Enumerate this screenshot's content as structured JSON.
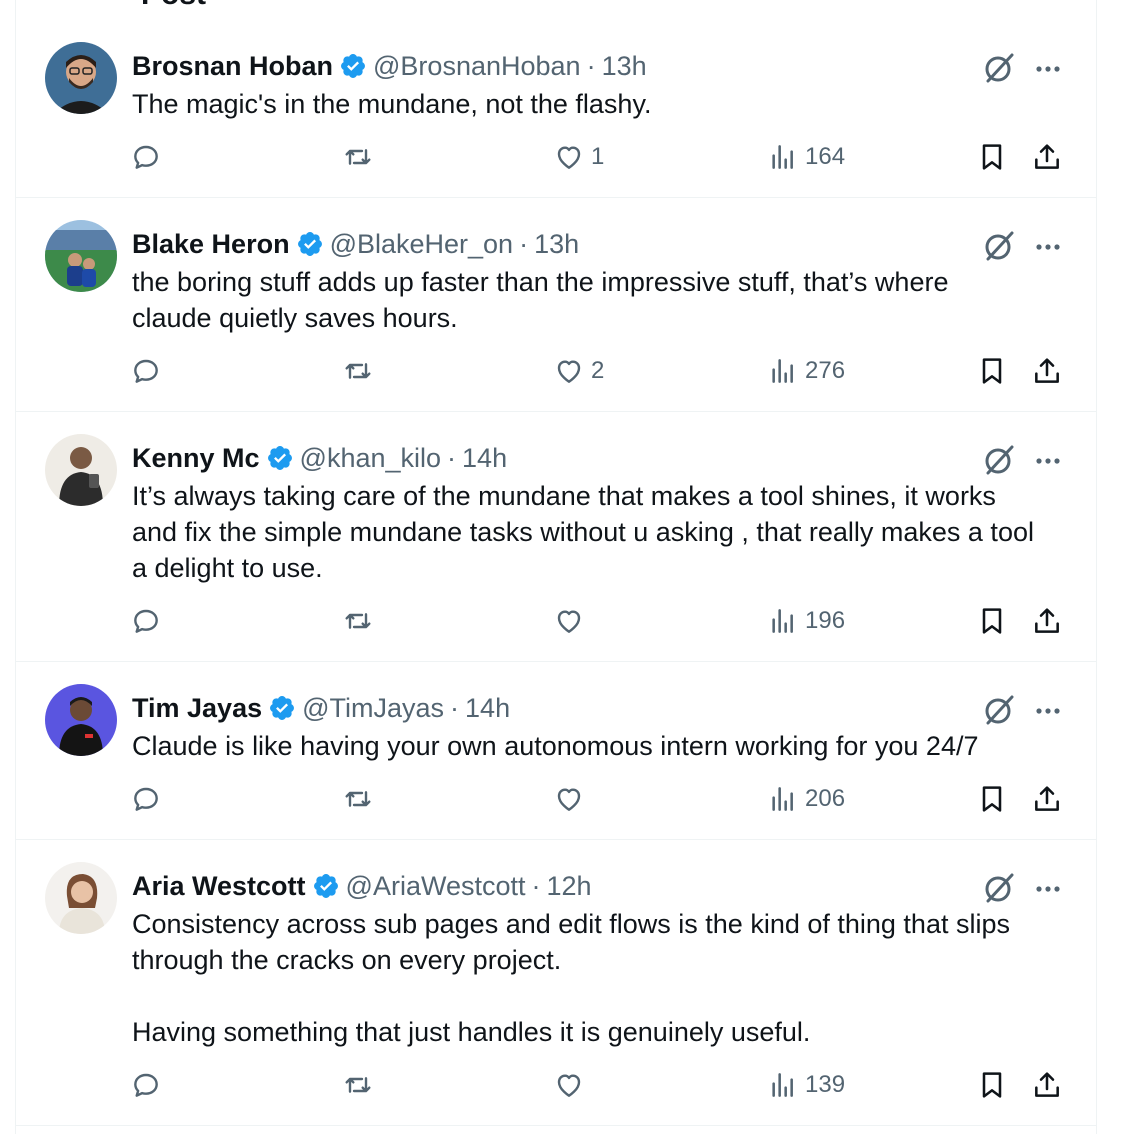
{
  "header": {
    "title": "Post"
  },
  "colors": {
    "verified": "#1d9bf0",
    "muted": "#536471",
    "text": "#0f1419"
  },
  "tweets": [
    {
      "name": "Brosnan Hoban",
      "handle": "@BrosnanHoban",
      "sep": "·",
      "time": "13h",
      "body": "The magic's in the mundane, not the flashy.",
      "replies": "",
      "reposts": "",
      "likes": "1",
      "views": "164"
    },
    {
      "name": "Blake Heron",
      "handle": "@BlakeHer_on",
      "sep": "·",
      "time": "13h",
      "body": "the boring stuff adds up faster than the impressive stuff, that’s where\nclaude quietly saves hours.",
      "replies": "",
      "reposts": "",
      "likes": "2",
      "views": "276"
    },
    {
      "name": "Kenny Mc",
      "handle": "@khan_kilo",
      "sep": "·",
      "time": "14h",
      "body": "It’s always taking care of the mundane that makes a tool shines, it works\nand fix the simple mundane tasks without u asking , that really makes a tool\na delight to use.",
      "replies": "",
      "reposts": "",
      "likes": "",
      "views": "196"
    },
    {
      "name": "Tim Jayas",
      "handle": "@TimJayas",
      "sep": "·",
      "time": "14h",
      "body": "Claude is like having your own autonomous intern working for you 24/7",
      "replies": "",
      "reposts": "",
      "likes": "",
      "views": "206"
    },
    {
      "name": "Aria Westcott",
      "handle": "@AriaWestcott",
      "sep": "·",
      "time": "12h",
      "body": "Consistency across sub pages and edit flows is the kind of thing that slips\nthrough the cracks on every project.\n\nHaving something that just handles it is genuinely useful.",
      "replies": "",
      "reposts": "",
      "likes": "",
      "views": "139"
    }
  ]
}
